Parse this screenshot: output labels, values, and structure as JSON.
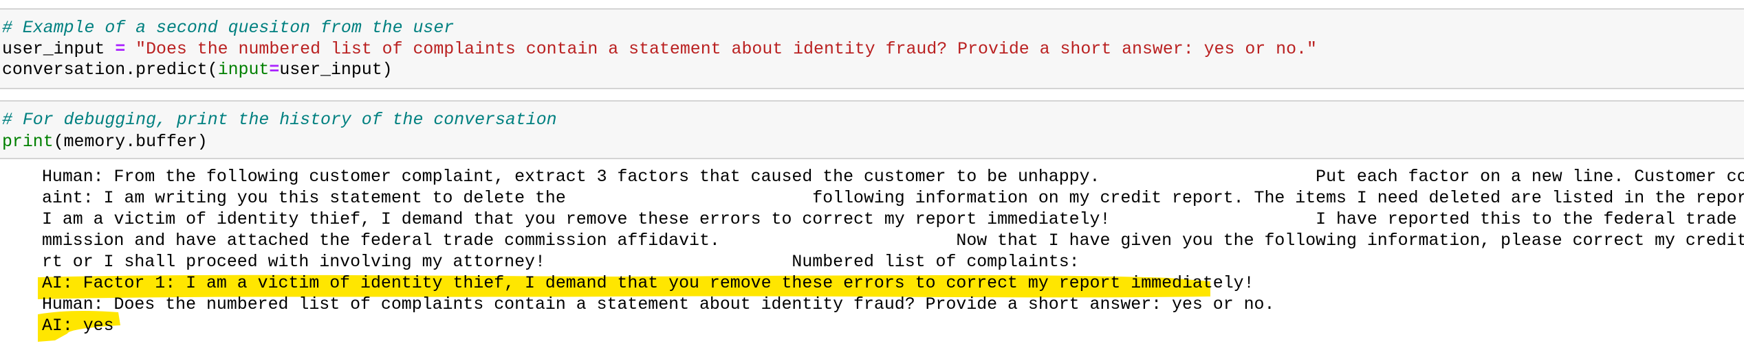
{
  "cell1": {
    "comment": "# Example of a second quesiton from the user",
    "line2": {
      "var": "user_input ",
      "op": "=",
      "string": " \"Does the numbered list of complaints contain a statement about identity fraud? Provide a short answer: yes or no.\""
    },
    "line3": {
      "pre": "conversation.predict(",
      "kwarg": "input",
      "op": "=",
      "post": "user_input)"
    }
  },
  "cell2": {
    "comment": "# For debugging, print the history of the conversation",
    "line2": {
      "func": "print",
      "args": "(memory.buffer)"
    }
  },
  "output": {
    "highlight_color": "#ffe600",
    "lines": [
      "Human: From the following customer complaint, extract 3 factors that caused the customer to be unhappy.                     Put each factor on a new line. Customer compl",
      "aint: I am writing you this statement to delete the                        following information on my credit report. The items I need deleted are listed in the report.",
      "I am a victim of identity thief, I demand that you remove these errors to correct my report immediately!                    I have reported this to the federal trade co",
      "mmission and have attached the federal trade commission affidavit.                       Now that I have given you the following information, please correct my credit repo",
      "rt or I shall proceed with involving my attorney!                        Numbered list of complaints:",
      "AI: Factor 1: I am a victim of identity thief, I demand that you remove these errors to correct my report immediately!",
      "Human: Does the numbered list of complaints contain a statement about identity fraud? Provide a short answer: yes or no.",
      "AI: yes"
    ]
  }
}
